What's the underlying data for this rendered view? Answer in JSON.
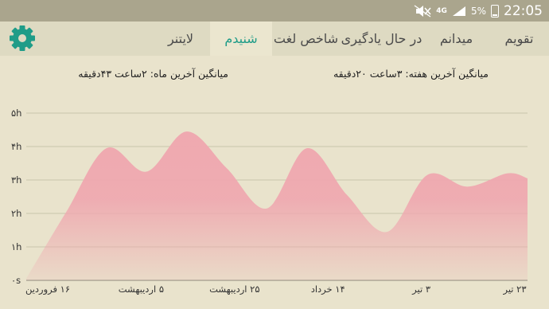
{
  "status_bar": {
    "time": "22:05",
    "battery": "5%",
    "network": "4G"
  },
  "toolbar": {
    "settings_icon": "gear-icon",
    "tabs": [
      {
        "label": "تقویم",
        "active": false
      },
      {
        "label": "میدانم",
        "active": false
      },
      {
        "label": "در حال یادگیری",
        "active": false
      },
      {
        "label": "شاخص لغت",
        "active": false
      },
      {
        "label": "شنیدم",
        "active": true
      },
      {
        "label": "لایتنر",
        "active": false
      }
    ]
  },
  "stats": {
    "week": "میانگین آخرین هفته: ۳ساعت  ۲۰دقیقه",
    "month": "میانگین آخرین ماه: ۲ساعت  ۴۳دقیقه"
  },
  "colors": {
    "accent": "#1f9c88",
    "fill": "#efa9b0"
  },
  "chart_data": {
    "type": "area",
    "y_ticks": [
      "۰s",
      "۱h",
      "۲h",
      "۳h",
      "۴h",
      "۵h"
    ],
    "ylim": [
      0,
      5
    ],
    "x_ticks": [
      "۱۶ فروردین",
      "۵ اردیبهشت",
      "۲۵ اردیبهشت",
      "۱۴ خرداد",
      "۳ تیر",
      "۲۳ تیر"
    ],
    "x": [
      0,
      10,
      20,
      30,
      40,
      50,
      60,
      70,
      80,
      90,
      100,
      110,
      120,
      125
    ],
    "values": [
      0.05,
      2.05,
      3.95,
      3.25,
      4.45,
      3.35,
      2.15,
      3.95,
      2.55,
      1.45,
      3.15,
      2.8,
      3.2,
      3.05
    ],
    "grid": true
  }
}
